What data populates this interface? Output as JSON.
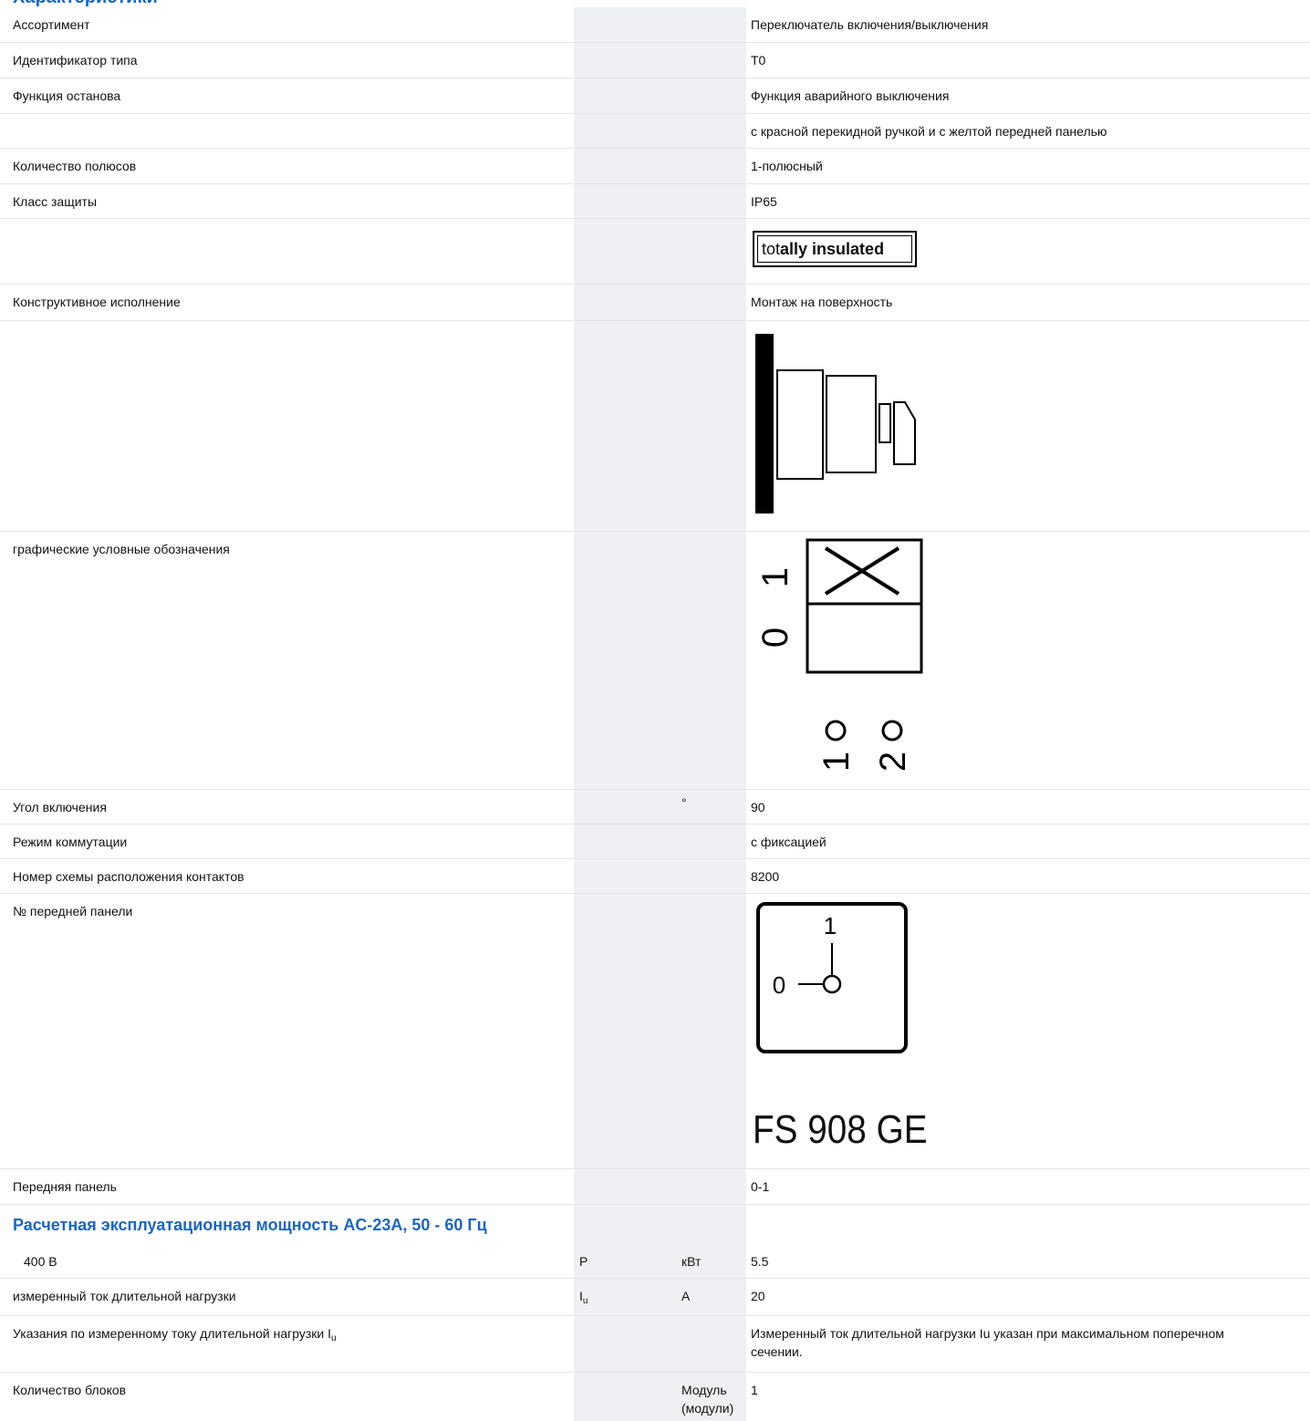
{
  "header": {
    "partial_title": "Характеристики"
  },
  "rows": {
    "assortment": {
      "label": "Ассортимент",
      "value": "Переключатель включения/выключения"
    },
    "type_id": {
      "label": "Идентификатор типа",
      "value": "T0"
    },
    "stop_function": {
      "label": "Функция останова",
      "value": "Функция аварийного выключения"
    },
    "stop_function_note": {
      "value": "с красной перекидной ручкой и с желтой передней панелью"
    },
    "poles": {
      "label": "Количество полюсов",
      "value": "1-полюсный"
    },
    "protection": {
      "label": "Класс защиты",
      "value": "IP65"
    },
    "insulated_badge": {
      "text_normal": "tot",
      "text_mid": "ally ",
      "text_bold": "insulated"
    },
    "design": {
      "label": "Конструктивное исполнение",
      "value": "Монтаж на поверхность"
    },
    "graphic_symbols": {
      "label": "графические условные обозначения",
      "pos0": "0",
      "pos1": "1",
      "contact1": "1",
      "contact2": "2"
    },
    "switch_angle": {
      "label": "Угол включения",
      "unit": "°",
      "value": "90"
    },
    "switch_mode": {
      "label": "Режим коммутации",
      "value": "с фиксацией"
    },
    "contact_scheme": {
      "label": "Номер схемы расположения контактов",
      "value": "8200"
    },
    "front_plate_no": {
      "label": "№ передней панели",
      "dial_0": "0",
      "dial_1": "1",
      "caption": "FS 908 GE"
    },
    "front_plate": {
      "label": "Передняя панель",
      "value": "0-1"
    },
    "section_power": {
      "title": "Расчетная эксплуатационная мощность AC-23A, 50 - 60 Гц"
    },
    "power_400v": {
      "label": "400 В",
      "symbol": "P",
      "unit": "кВт",
      "value": "5.5"
    },
    "rated_current": {
      "label": "измеренный ток длительной нагрузки",
      "symbol_main": "I",
      "symbol_sub": "u",
      "unit": "A",
      "value": "20"
    },
    "current_note": {
      "label_main": "Указания по измеренному току длительной нагрузки I",
      "label_sub": "u",
      "value": "Измеренный ток длительной нагрузки Iu указан при максимальном поперечном сечении."
    },
    "blocks": {
      "label": "Количество блоков",
      "unit_line1": "Модуль",
      "unit_line2": "(модули)",
      "value": "1"
    }
  }
}
